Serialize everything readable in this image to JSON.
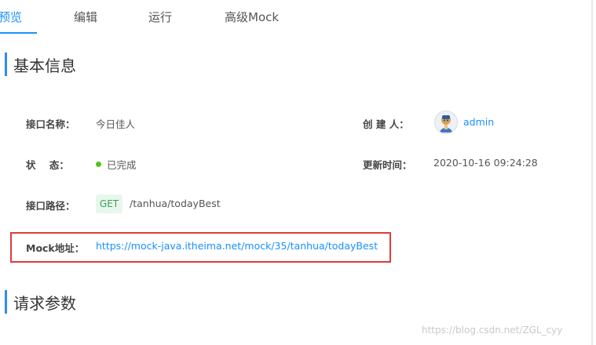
{
  "tabs": [
    {
      "label": "预览",
      "active": true
    },
    {
      "label": "编辑",
      "active": false
    },
    {
      "label": "运行",
      "active": false
    },
    {
      "label": "高级Mock",
      "active": false
    }
  ],
  "basic_info": {
    "title": "基本信息",
    "name_label": "接口名称：",
    "name_value": "今日佳人",
    "status_label": "状    态：",
    "status_value": "已完成",
    "status_color": "#52c41a",
    "path_label": "接口路径：",
    "method": "GET",
    "path": "/tanhua/todayBest",
    "creator_label": "创 建 人：",
    "creator": "admin",
    "updated_label": "更新时间：",
    "updated": "2020-10-16 09:24:28",
    "mock_label": "Mock地址：",
    "mock_url": "https://mock-java.itheima.net/mock/35/tanhua/todayBest"
  },
  "request_params": {
    "title": "请求参数"
  },
  "watermark": "https://blog.csdn.net/ZGL_cyy",
  "colors": {
    "accent": "#1890ff",
    "highlight_box": "#e03a3a",
    "get_tag_text": "#36a25a"
  }
}
